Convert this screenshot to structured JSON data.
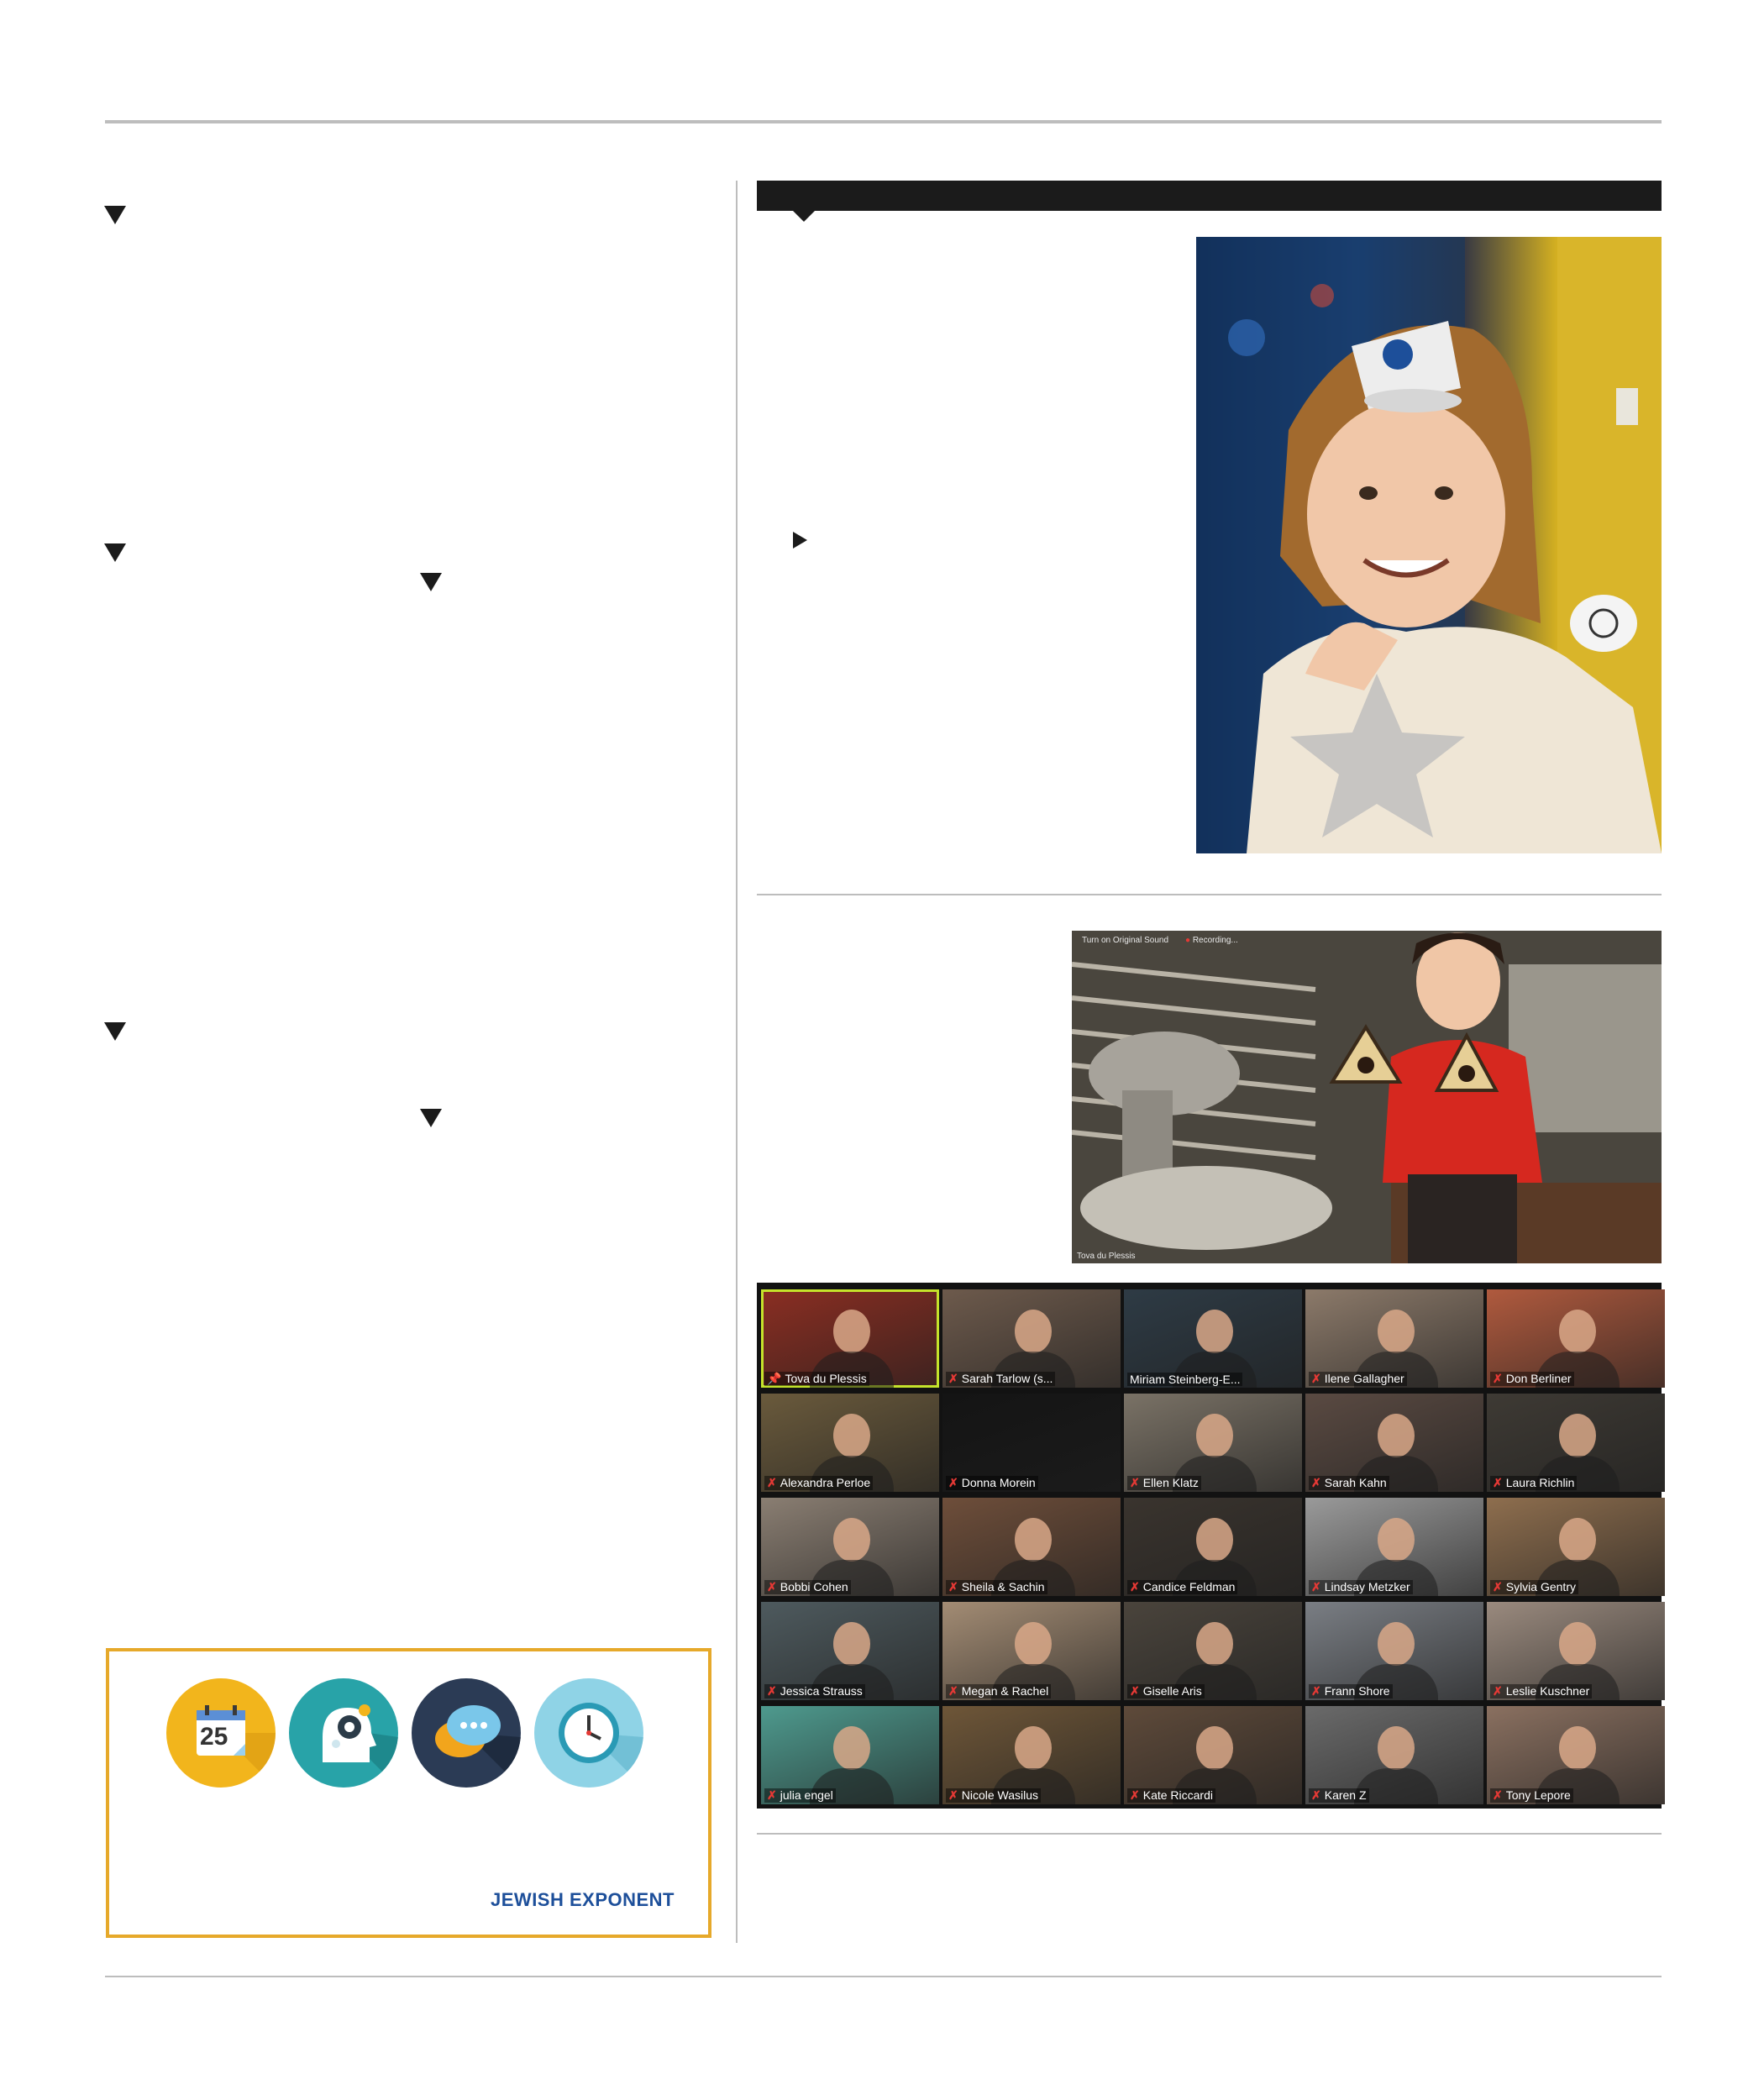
{
  "advertisement": {
    "logo_text": "JEWISH EXPONENT",
    "icons": [
      "calendar-icon",
      "head-gear-icon",
      "chat-bubbles-icon",
      "clock-icon"
    ],
    "calendar_day": "25",
    "colors": {
      "border": "#e6a92a",
      "logo": "#1d4f9a"
    }
  },
  "photo_top": {
    "subject": "girl-with-paper-cup-hat"
  },
  "photo_middle": {
    "overlay_left": "Turn on Original Sound",
    "overlay_recording": "Recording...",
    "overlay_name": "Tova du Plessis"
  },
  "zoom_grid": {
    "tiles": [
      {
        "name": "Tova du Plessis",
        "muted": false,
        "pinned": true,
        "active": true,
        "bg": "#8b2e22"
      },
      {
        "name": "Sarah Tarlow (s...",
        "muted": true,
        "bg": "#6d5a4c"
      },
      {
        "name": "Miriam Steinberg-E...",
        "muted": false,
        "bg": "#2e3b45"
      },
      {
        "name": "Ilene Gallagher",
        "muted": true,
        "bg": "#8c7a6a"
      },
      {
        "name": "Don Berliner",
        "muted": true,
        "bg": "#b05a3e"
      },
      {
        "name": "Alexandra Perloe",
        "muted": true,
        "bg": "#6a5a3c"
      },
      {
        "name": "Donna Morein",
        "muted": true,
        "bg": "#141414"
      },
      {
        "name": "Ellen Klatz",
        "muted": true,
        "bg": "#7a7266"
      },
      {
        "name": "Sarah Kahn",
        "muted": true,
        "bg": "#5a4a42"
      },
      {
        "name": "Laura Richlin",
        "muted": true,
        "bg": "#3e3a34"
      },
      {
        "name": "Bobbi Cohen",
        "muted": true,
        "bg": "#8a7e72"
      },
      {
        "name": "Sheila & Sachin",
        "muted": true,
        "bg": "#6e4e3a"
      },
      {
        "name": "Candice Feldman",
        "muted": true,
        "bg": "#3a342e"
      },
      {
        "name": "Lindsay Metzker",
        "muted": true,
        "bg": "#9a9a9a"
      },
      {
        "name": "Sylvia Gentry",
        "muted": true,
        "bg": "#8e6e4e"
      },
      {
        "name": "Jessica Strauss",
        "muted": true,
        "bg": "#4e5a5e"
      },
      {
        "name": "Megan & Rachel",
        "muted": true,
        "bg": "#a38c74"
      },
      {
        "name": "Giselle Aris",
        "muted": true,
        "bg": "#4a443c"
      },
      {
        "name": "Frann Shore",
        "muted": true,
        "bg": "#7a7e84"
      },
      {
        "name": "Leslie Kuschner",
        "muted": true,
        "bg": "#9a8a7e"
      },
      {
        "name": "julia engel",
        "muted": true,
        "bg": "#4e9a8e"
      },
      {
        "name": "Nicole Wasilus",
        "muted": true,
        "bg": "#6e5638"
      },
      {
        "name": "Kate Riccardi",
        "muted": true,
        "bg": "#5e4a3a"
      },
      {
        "name": "Karen Z",
        "muted": true,
        "bg": "#6a6a6a"
      },
      {
        "name": "Tony Lepore",
        "muted": true,
        "bg": "#8a7060"
      }
    ]
  }
}
